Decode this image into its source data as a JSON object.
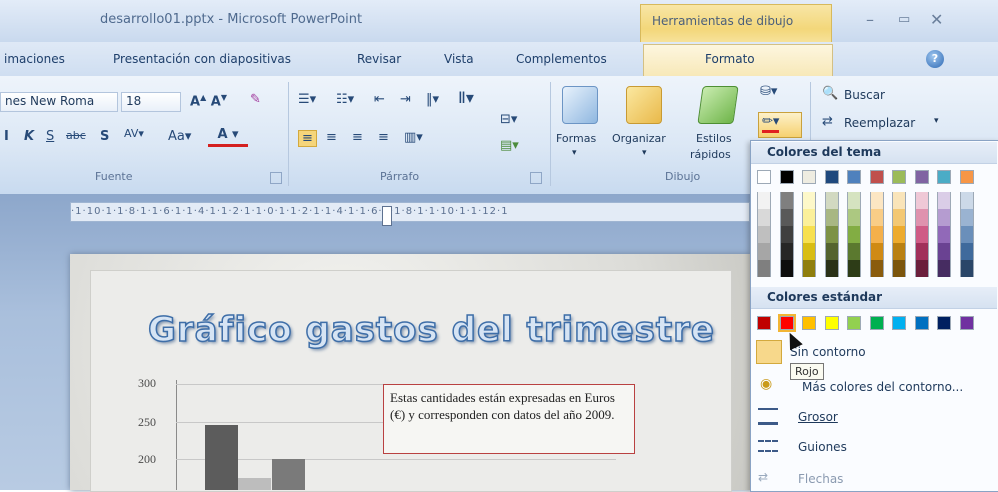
{
  "window": {
    "title": "desarrollo01.pptx - Microsoft PowerPoint",
    "tools_header": "Herramientas de dibujo",
    "controls": [
      "–",
      "▭",
      "✕"
    ]
  },
  "tabs": [
    "imaciones",
    "Presentación con diapositivas",
    "Revisar",
    "Vista",
    "Complementos",
    "Formato"
  ],
  "ribbon": {
    "font": {
      "name": "nes New Roma",
      "size": "18",
      "group_label": "Fuente"
    },
    "paragraph": {
      "group_label": "Párrafo"
    },
    "drawing": {
      "group_label": "Dibujo",
      "formas": "Formas",
      "organizar": "Organizar",
      "estilos": "Estilos",
      "rapidos": "rápidos"
    },
    "editing": {
      "buscar": "Buscar",
      "reemplazar": "Reemplazar"
    }
  },
  "ruler_text": "·1·10·1·1·8·1·1·6·1·1·4·1·1·2·1·1·0·1·1·2·1·1·4·1·1·6·1·1·8·1·1·10·1·1·12·1",
  "slide": {
    "title": "Gráfico gastos del trimestre",
    "y_labels": [
      "300",
      "250",
      "200"
    ],
    "textbox": "Estas cantidades están expresadas en Euros (€) y corresponden con datos del año 2009."
  },
  "chart_data": {
    "type": "bar",
    "categories": [
      "",
      ""
    ],
    "series": [
      {
        "values": [
          245,
          200
        ]
      },
      {
        "values": [
          175,
          null
        ]
      }
    ],
    "ylabel": "",
    "ylim": [
      150,
      300
    ],
    "y_ticks": [
      200,
      250,
      300
    ]
  },
  "color_menu": {
    "theme_header": "Colores del tema",
    "standard_header": "Colores estándar",
    "theme_top": [
      "#ffffff",
      "#000000",
      "#eeece1",
      "#1f497d",
      "#4f81bd",
      "#c0504d",
      "#9bbb59",
      "#8064a2",
      "#4bacc6",
      "#f79646"
    ],
    "theme_columns": [
      [
        "#f2f2f2",
        "#d9d9d9",
        "#bfbfbf",
        "#a6a6a6",
        "#7f7f7f"
      ],
      [
        "#7f7f7f",
        "#595959",
        "#3f3f3f",
        "#262626",
        "#0d0d0d"
      ],
      [
        "#fdf8c9",
        "#fbf09a",
        "#f7e04f",
        "#d8bd13",
        "#8f7e0d"
      ],
      [
        "#d2d9c1",
        "#a8b783",
        "#7d9245",
        "#54632e",
        "#2a3117"
      ],
      [
        "#d5e3c0",
        "#acc881",
        "#82ad43",
        "#5b792f",
        "#2d3c17"
      ],
      [
        "#fce6c3",
        "#f9cd87",
        "#f4b04b",
        "#d08a14",
        "#8a5c0d"
      ],
      [
        "#f9e4b9",
        "#f3c874",
        "#edab2e",
        "#b98012",
        "#7b550c"
      ],
      [
        "#efc8d6",
        "#df92ae",
        "#cf5b86",
        "#a12f5a",
        "#6b1f3c"
      ],
      [
        "#dacde7",
        "#b59cd0",
        "#9169b8",
        "#6a4292",
        "#462c61"
      ],
      [
        "#ccd9e8",
        "#9ab3d1",
        "#6a8fba",
        "#3f6a9c",
        "#2a4668"
      ]
    ],
    "standard": [
      "#c00000",
      "#ff0000",
      "#ffc000",
      "#ffff00",
      "#92d050",
      "#00b050",
      "#00b0f0",
      "#0070c0",
      "#002060",
      "#7030a0"
    ],
    "items": {
      "sin_contorno": "Sin contorno",
      "mas_colores": "Más colores del contorno...",
      "grosor": "Grosor",
      "guiones": "Guiones",
      "flechas": "Flechas"
    },
    "tooltip": "Rojo"
  }
}
